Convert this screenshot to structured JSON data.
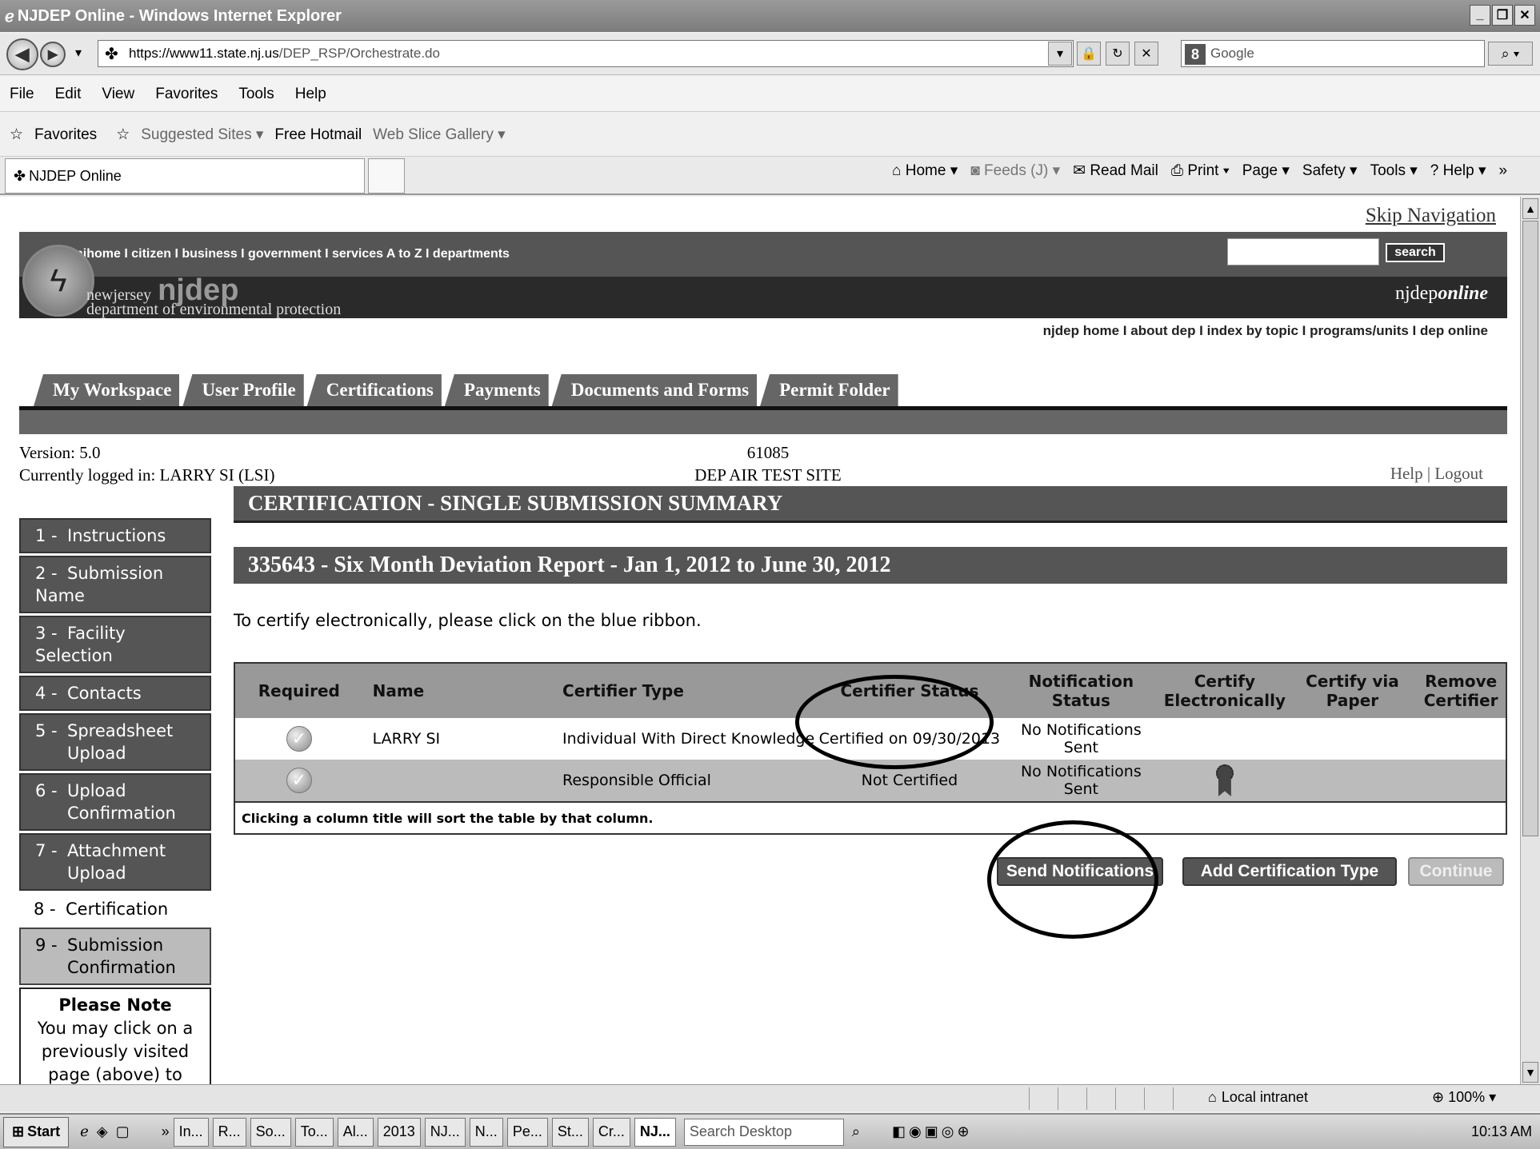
{
  "browser": {
    "title": "NJDEP Online - Windows Internet Explorer",
    "url_domain": "https://www11.state.nj.us",
    "url_path": "/DEP_RSP/Orchestrate.do",
    "search_engine": "Google",
    "menu": [
      "File",
      "Edit",
      "View",
      "Favorites",
      "Tools",
      "Help"
    ],
    "favorites": {
      "favorites_label": "Favorites",
      "suggested": "Suggested Sites ▾",
      "hotmail": "Free Hotmail",
      "webslice": "Web Slice Gallery ▾"
    },
    "tab_title": "NJDEP Online",
    "commands": {
      "home": "Home",
      "feeds": "Feeds (J)",
      "readmail": "Read Mail",
      "print": "Print",
      "page": "Page ▾",
      "safety": "Safety ▾",
      "tools": "Tools ▾",
      "help": "Help ▾"
    },
    "status": {
      "zone": "Local intranet",
      "zoom": "100%"
    }
  },
  "site": {
    "skip_nav": "Skip Navigation",
    "header_links": "njhome  I  citizen  I  business  I  government  I  services A to Z  I  departments",
    "search_button": "search",
    "agency_small": "newjersey",
    "agency_big": "njdep",
    "agency_full": "department of environmental protection",
    "online_brand_prefix": "njdep",
    "online_brand_suffix": "online",
    "top_links": "njdep home  I  about dep  I  index by topic  I  programs/units  I  dep online",
    "tabs": [
      "My Workspace",
      "User Profile",
      "Certifications",
      "Payments",
      "Documents and Forms",
      "Permit Folder"
    ],
    "version": "Version: 5.0",
    "logged_in": "Currently logged in: LARRY SI (LSI)",
    "site_id": "61085",
    "site_name": "DEP AIR TEST SITE",
    "help_logout": "Help | Logout"
  },
  "page": {
    "summary_title": "CERTIFICATION - SINGLE SUBMISSION SUMMARY",
    "report_title": "335643 - Six Month Deviation Report - Jan 1, 2012 to June 30, 2012",
    "instructions": "To certify electronically, please click on the blue ribbon."
  },
  "sidenav": [
    {
      "num": "1 -",
      "label": "Instructions",
      "label2": ""
    },
    {
      "num": "2 -",
      "label": "Submission Name",
      "label2": ""
    },
    {
      "num": "3 -",
      "label": "Facility Selection",
      "label2": ""
    },
    {
      "num": "4 -",
      "label": "Contacts",
      "label2": ""
    },
    {
      "num": "5 -",
      "label": "Spreadsheet",
      "label2": "Upload"
    },
    {
      "num": "6 -",
      "label": "Upload",
      "label2": "Confirmation"
    },
    {
      "num": "7 -",
      "label": "Attachment",
      "label2": "Upload"
    },
    {
      "num": "8 -",
      "label": "Certification",
      "label2": ""
    },
    {
      "num": "9 -",
      "label": "Submission",
      "label2": "Confirmation"
    }
  ],
  "note": {
    "title": "Please Note",
    "text": "You may click on a previously visited page (above) to navigate back to that screen."
  },
  "table": {
    "headers": [
      "Required",
      "Name",
      "Certifier Type",
      "Certifier Status",
      "Notification Status",
      "Certify Electronically",
      "Certify via Paper",
      "Remove Certifier"
    ],
    "rows": [
      {
        "name": "LARRY SI",
        "type": "Individual With Direct Knowledge",
        "status": "Certified on 09/30/2013",
        "notification": "No Notifications Sent"
      },
      {
        "name": "",
        "type": "Responsible Official",
        "status": "Not Certified",
        "notification": "No Notifications Sent"
      }
    ],
    "footer": "Clicking a column title will sort the table by that column."
  },
  "buttons": {
    "send": "Send Notifications",
    "add": "Add Certification Type",
    "continue": "Continue"
  },
  "taskbar": {
    "start": "Start",
    "items": [
      "In...",
      "R...",
      "So...",
      "To...",
      "Al...",
      "2013",
      "NJ...",
      "N...",
      "Pe...",
      "St...",
      "Cr...",
      "NJ..."
    ],
    "search": "Search Desktop",
    "time": "10:13 AM"
  }
}
